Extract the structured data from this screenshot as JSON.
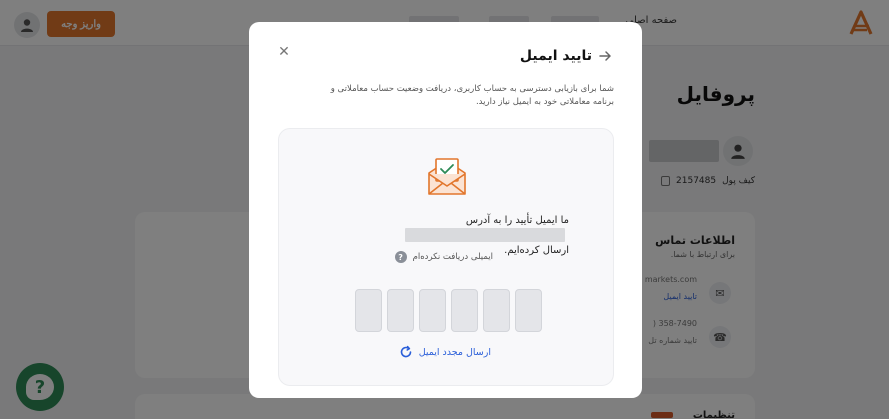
{
  "header": {
    "nav_home": "صفحه اصلی",
    "deposit_label": "واریز وجه"
  },
  "profile": {
    "title": "پروفایل",
    "wallet_label": "کیف پول",
    "wallet_id": "2157485"
  },
  "contact": {
    "title": "اطلاعات تماس",
    "subtitle": "برای ارتباط با شما.",
    "email_partial": "markets.com",
    "verify_email": "تایید ایمیل",
    "phone_partial": ") 358-7490",
    "verify_phone": "تایید شماره تل"
  },
  "bottom_card": {
    "title": "تنظیمات"
  },
  "help": {
    "glyph": "?"
  },
  "modal": {
    "title": "تایید ایمیل",
    "description": "شما برای بازیابی دسترسی به حساب کاربری، دریافت وضعیت حساب معاملاتی و برنامه معاملاتی خود به ایمیل نیاز دارید.",
    "sent_prefix": "ما ایمیل تأیید را به آدرس",
    "sent_suffix": "ارسال کرده‌ایم.",
    "not_received": "ایمیلی دریافت نکرده‌ام",
    "otp": [
      "",
      "",
      "",
      "",
      "",
      ""
    ],
    "resend": "ارسال مجدد ایمیل"
  },
  "colors": {
    "accent_orange": "#e2762c",
    "link_blue": "#2b5fd9",
    "help_green": "#2e8b57"
  }
}
